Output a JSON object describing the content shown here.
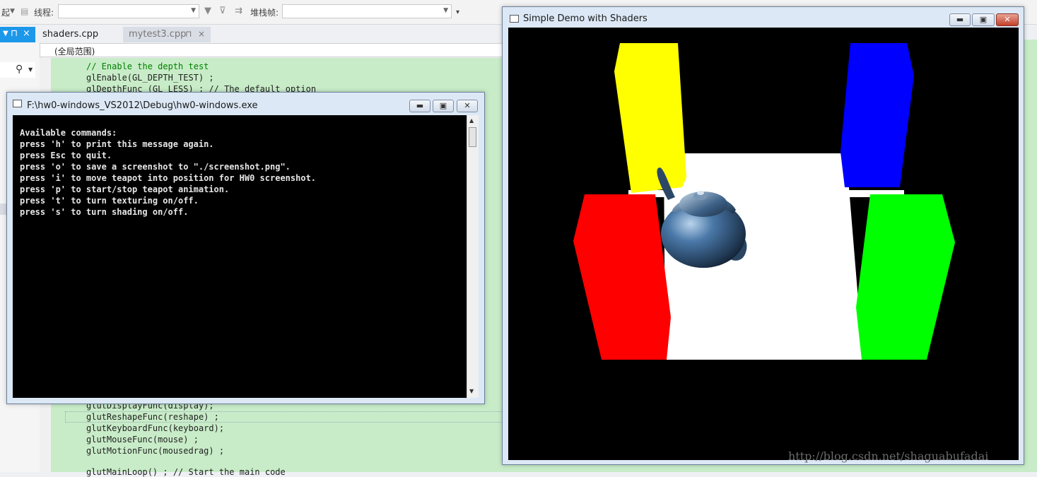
{
  "toolbar": {
    "truncated_label": "起",
    "thread_label": "线程:",
    "stack_frame_label": "堆栈帧:"
  },
  "tabs": {
    "pin_glyph": "⊓",
    "close_glyph": "×",
    "active": "shaders.cpp",
    "inactive": "mytest3.cpp"
  },
  "scope": "(全局范围)",
  "code_top": [
    "// Enable the depth test",
    "glEnable(GL_DEPTH_TEST) ;",
    "glDepthFunc (GL_LESS) ; // The default option"
  ],
  "code_bottom": [
    "glutDisplayFunc(display);",
    "glutReshapeFunc(reshape) ;",
    "glutKeyboardFunc(keyboard);",
    "glutMouseFunc(mouse) ;",
    "glutMotionFunc(mousedrag) ;",
    "glutMainLoop() ; // Start the main code"
  ],
  "console": {
    "title": "F:\\hw0-windows_VS2012\\Debug\\hw0-windows.exe",
    "lines": [
      "Available commands:",
      "press 'h' to print this message again.",
      "press Esc to quit.",
      "press 'o' to save a screenshot to \"./screenshot.png\".",
      "press 'i' to move teapot into position for HW0 screenshot.",
      "press 'p' to start/stop teapot animation.",
      "press 't' to turn texturing on/off.",
      "press 's' to turn shading on/off."
    ]
  },
  "glwindow": {
    "title": "Simple Demo with Shaders",
    "watermark": "http://blog.csdn.net/shaguabufadai"
  },
  "icons": {
    "search": "search-icon",
    "pin": "pin-icon",
    "close": "close-icon",
    "minimize": "minimize-icon",
    "maximize": "maximize-icon",
    "filter": "filter-icon"
  },
  "colors": {
    "accent": "#1c97ea",
    "editor_bg": "#c8ecc8",
    "pillar_yellow": "#ffff00",
    "pillar_blue": "#0000ff",
    "pillar_red": "#ff0000",
    "pillar_green": "#00ff00",
    "floor": "#ffffff"
  }
}
